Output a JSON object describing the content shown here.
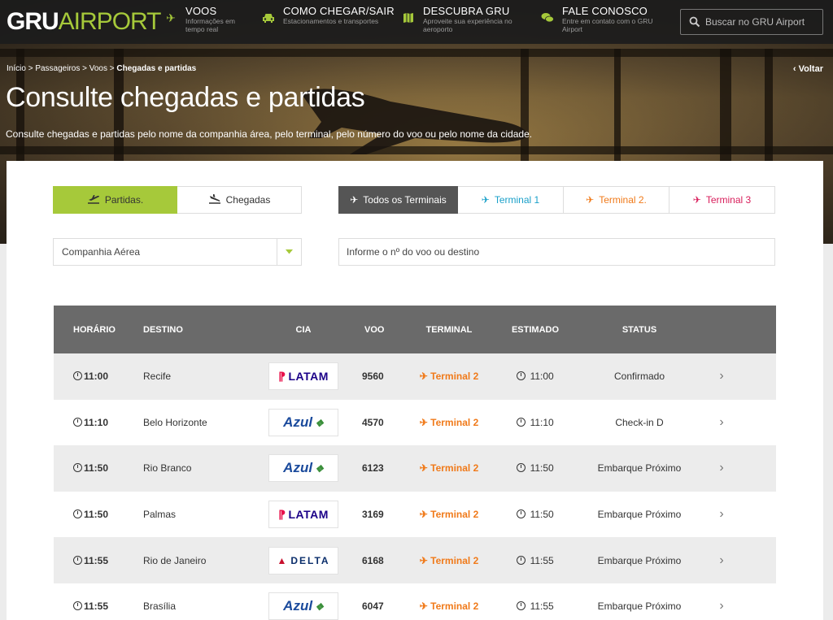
{
  "nav": {
    "logo_part1": "GRU",
    "logo_part2": "AIRPORT",
    "items": [
      {
        "title": "VOOS",
        "subtitle": "Informações em tempo real",
        "icon": "plane-icon"
      },
      {
        "title": "COMO CHEGAR/SAIR",
        "subtitle": "Estacionamentos e transportes",
        "icon": "car-icon"
      },
      {
        "title": "DESCUBRA GRU",
        "subtitle": "Aproveite sua experiência no aeroporto",
        "icon": "map-icon"
      },
      {
        "title": "FALE CONOSCO",
        "subtitle": "Entre em contato com o GRU Airport",
        "icon": "chat-icon"
      }
    ],
    "search_placeholder": "Buscar no GRU Airport"
  },
  "breadcrumb": {
    "items": [
      "Início",
      "Passageiros",
      "Voos"
    ],
    "current": "Chegadas e partidas",
    "separator": ">"
  },
  "back_label": "Voltar",
  "title": "Consulte chegadas e partidas",
  "subtitle": "Consulte chegadas e partidas pelo nome da companhia área, pelo terminal, pelo número do voo ou pelo nome da cidade.",
  "direction_tabs": [
    {
      "label": "Partidas.",
      "active": true
    },
    {
      "label": "Chegadas",
      "active": false
    }
  ],
  "terminal_tabs": [
    {
      "label": "Todos os Terminais",
      "active": true,
      "color": "#ffffff"
    },
    {
      "label": "Terminal 1",
      "active": false,
      "color": "#1aa0c9"
    },
    {
      "label": "Terminal 2.",
      "active": false,
      "color": "#f07a1a"
    },
    {
      "label": "Terminal 3",
      "active": false,
      "color": "#d81e5b"
    }
  ],
  "filters": {
    "airline_select": "Companhia Aérea",
    "flight_placeholder": "Informe o nº do voo ou destino"
  },
  "table": {
    "headers": [
      "HORÁRIO",
      "DESTINO",
      "CIA",
      "VOO",
      "TERMINAL",
      "ESTIMADO",
      "STATUS"
    ],
    "rows": [
      {
        "time": "11:00",
        "dest": "Recife",
        "cia": "LATAM",
        "voo": "9560",
        "terminal": "Terminal 2",
        "est": "11:00",
        "status": "Confirmado"
      },
      {
        "time": "11:10",
        "dest": "Belo Horizonte",
        "cia": "Azul",
        "voo": "4570",
        "terminal": "Terminal 2",
        "est": "11:10",
        "status": "Check-in D"
      },
      {
        "time": "11:50",
        "dest": "Rio Branco",
        "cia": "Azul",
        "voo": "6123",
        "terminal": "Terminal 2",
        "est": "11:50",
        "status": "Embarque Próximo"
      },
      {
        "time": "11:50",
        "dest": "Palmas",
        "cia": "LATAM",
        "voo": "3169",
        "terminal": "Terminal 2",
        "est": "11:50",
        "status": "Embarque Próximo"
      },
      {
        "time": "11:55",
        "dest": "Rio de Janeiro",
        "cia": "DELTA",
        "voo": "6168",
        "terminal": "Terminal 2",
        "est": "11:55",
        "status": "Embarque Próximo"
      },
      {
        "time": "11:55",
        "dest": "Brasília",
        "cia": "Azul",
        "voo": "6047",
        "terminal": "Terminal 2",
        "est": "11:55",
        "status": "Embarque Próximo"
      }
    ]
  },
  "colors": {
    "accent": "#a6c93a",
    "terminal2": "#f07a1a",
    "header_bg": "#6a6a6a"
  }
}
